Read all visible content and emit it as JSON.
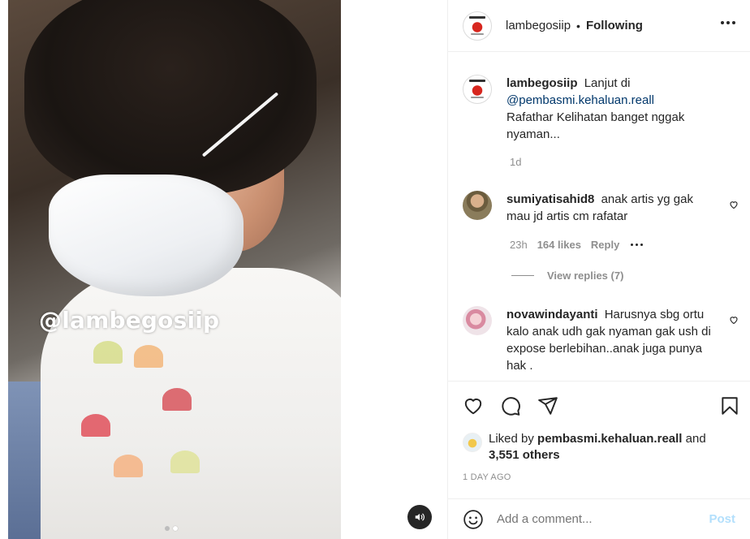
{
  "post": {
    "watermark": "@lambegosiip",
    "carousel": {
      "count": 2,
      "active_index": 1
    }
  },
  "header": {
    "username": "lambegosiip",
    "separator": "•",
    "follow_status": "Following"
  },
  "caption": {
    "username": "lambegosiip",
    "text_prefix": "Lanjut di",
    "mention": "@pembasmi.kehaluan.reall",
    "text_rest": "Rafathar Kelihatan banget nggak nyaman...",
    "time": "1d"
  },
  "comments": [
    {
      "username": "sumiyatisahid8",
      "text": "anak artis yg gak mau jd artis cm rafatar",
      "time": "23h",
      "likes": "164 likes",
      "reply_label": "Reply",
      "view_replies": "View replies (7)"
    },
    {
      "username": "novawindayanti",
      "text": "Harusnya sbg ortu kalo anak udh gak nyaman gak ush di expose berlebihan..anak juga punya hak ."
    }
  ],
  "liked_by": {
    "prefix": "Liked by",
    "user": "pembasmi.kehaluan.reall",
    "and": "and",
    "others": "3,551 others"
  },
  "date": "1 DAY AGO",
  "add_comment": {
    "placeholder": "Add a comment...",
    "post_label": "Post"
  },
  "colors": {
    "text": "#262626",
    "secondary": "#8e8e8e",
    "mention": "#00376b",
    "post_disabled": "#b2dffc",
    "border": "#efefef"
  },
  "icons": [
    "heart-icon",
    "comment-icon",
    "share-icon",
    "bookmark-icon",
    "emoji-icon",
    "speaker-icon",
    "more-icon"
  ]
}
